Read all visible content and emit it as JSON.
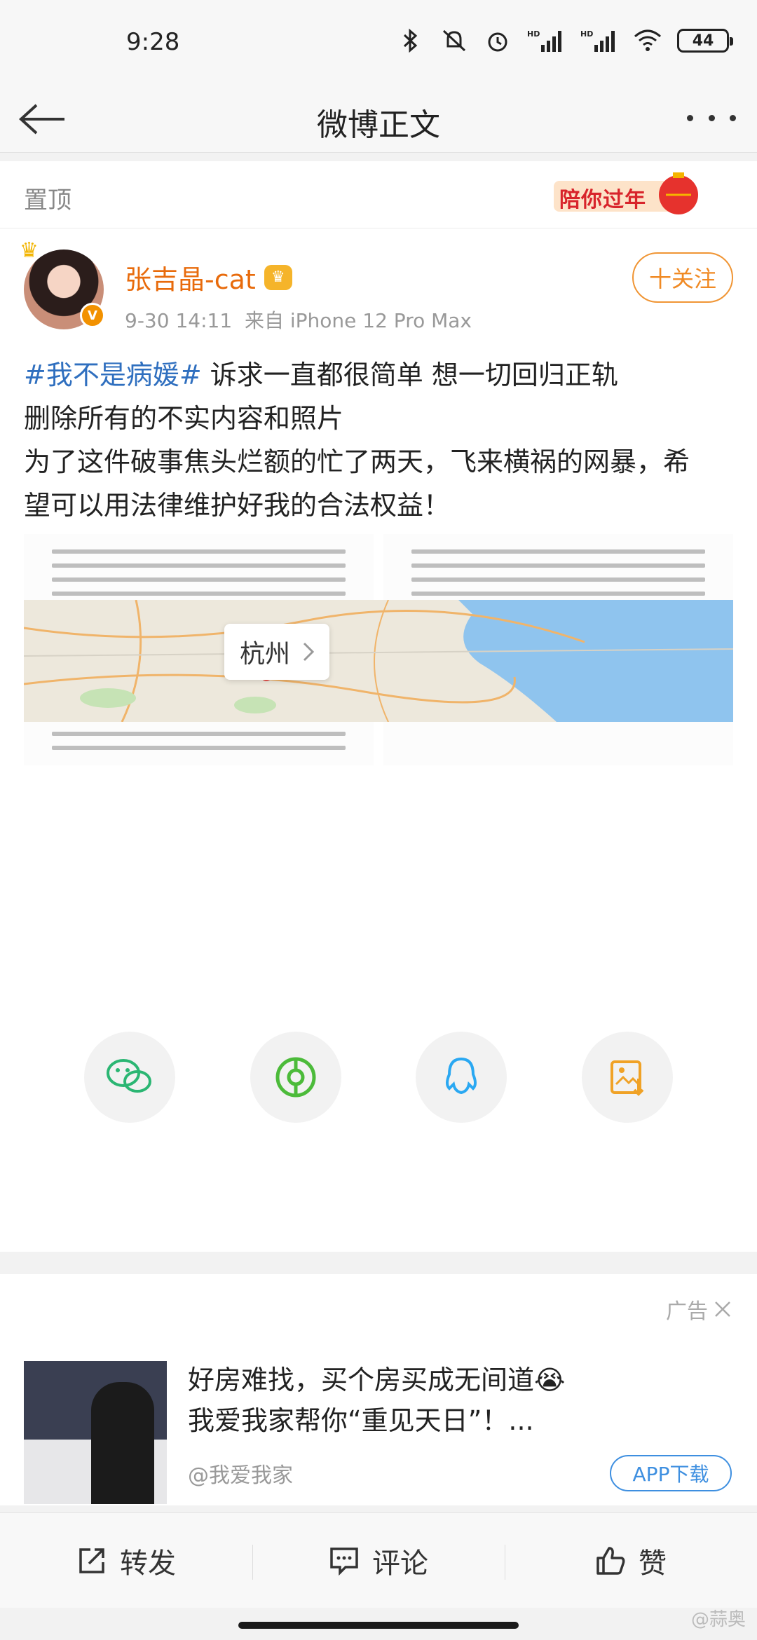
{
  "status_bar": {
    "time": "9:28",
    "battery": "44",
    "hd1": "HD",
    "hd2": "HD"
  },
  "nav": {
    "title": "微博正文"
  },
  "pinned": {
    "label": "置顶",
    "badge": "陪你过年"
  },
  "post": {
    "author": "张吉晶-cat",
    "time": "9-30 14:11",
    "source": "来自 iPhone 12 Pro Max",
    "follow_label": "十关注",
    "hashtag": "#我不是病媛#",
    "line1_rest": " 诉求一直都很简单 想一切回归正轨",
    "line2": "删除所有的不实内容和照片",
    "line3": "为了这件破事焦头烂额的忙了两天，飞来横祸的网暴，希",
    "line4": "望可以用法律维护好我的合法权益！"
  },
  "map": {
    "city": "杭州"
  },
  "share": {
    "icons": [
      "wechat-icon",
      "moments-icon",
      "qq-icon",
      "save-image-icon"
    ]
  },
  "ad": {
    "tag": "广告",
    "title_line1": "好房难找，买个房买成无间道😭",
    "title_line2": "我爱我家帮你“重见天日”！...",
    "source": "@我爱我家",
    "button": "APP下载"
  },
  "actions": {
    "repost": "转发",
    "comment": "评论",
    "like": "赞"
  },
  "watermark": "@蒜奥"
}
